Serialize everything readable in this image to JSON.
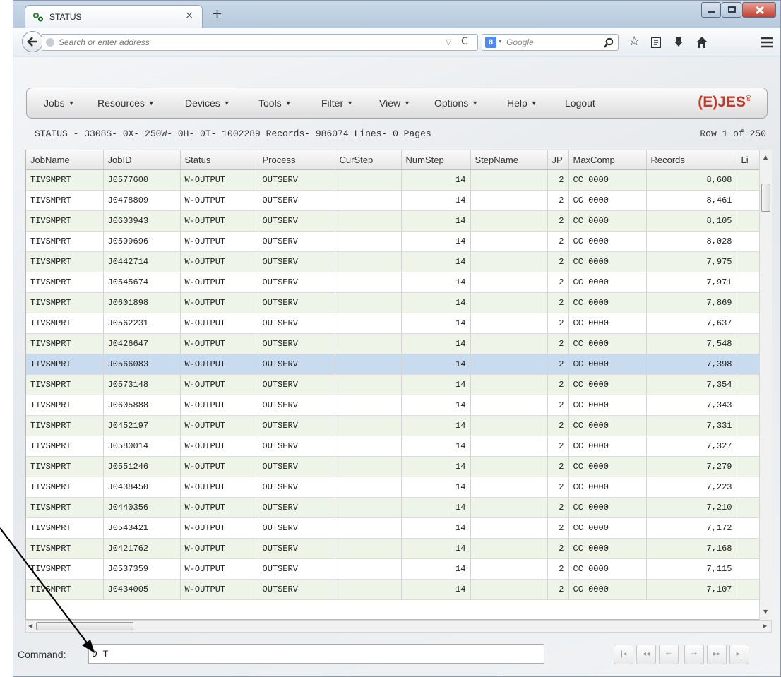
{
  "browser": {
    "tab_title": "STATUS",
    "tab_close": "×",
    "new_tab": "+",
    "url_placeholder": "Search or enter address",
    "search_badge": "8",
    "search_placeholder": "Google"
  },
  "menu": {
    "items": [
      {
        "label": "Jobs",
        "dropdown": true
      },
      {
        "label": "Resources",
        "dropdown": true
      },
      {
        "label": "Devices",
        "dropdown": true
      },
      {
        "label": "Tools",
        "dropdown": true
      },
      {
        "label": "Filter",
        "dropdown": true
      },
      {
        "label": "View",
        "dropdown": true
      },
      {
        "label": "Options",
        "dropdown": true
      },
      {
        "label": "Help",
        "dropdown": true
      },
      {
        "label": "Logout",
        "dropdown": false
      }
    ],
    "brand": "(E)JES",
    "brand_mark": "®"
  },
  "status_line": "STATUS - 3308S- 0X- 250W- 0H- 0T- 1002289 Records- 986074 Lines- 0 Pages",
  "row_info": "Row 1 of 250",
  "table": {
    "columns": [
      "JobName",
      "JobID",
      "Status",
      "Process",
      "CurStep",
      "NumStep",
      "StepName",
      "JP",
      "MaxComp",
      "Records",
      "Li"
    ],
    "rows": [
      [
        "TIVSMPRT",
        "J0577600",
        "W-OUTPUT",
        "OUTSERV",
        "",
        "14",
        "",
        "2",
        "CC 0000",
        "8,608"
      ],
      [
        "TIVSMPRT",
        "J0478809",
        "W-OUTPUT",
        "OUTSERV",
        "",
        "14",
        "",
        "2",
        "CC 0000",
        "8,461"
      ],
      [
        "TIVSMPRT",
        "J0603943",
        "W-OUTPUT",
        "OUTSERV",
        "",
        "14",
        "",
        "2",
        "CC 0000",
        "8,105"
      ],
      [
        "TIVSMPRT",
        "J0599696",
        "W-OUTPUT",
        "OUTSERV",
        "",
        "14",
        "",
        "2",
        "CC 0000",
        "8,028"
      ],
      [
        "TIVSMPRT",
        "J0442714",
        "W-OUTPUT",
        "OUTSERV",
        "",
        "14",
        "",
        "2",
        "CC 0000",
        "7,975"
      ],
      [
        "TIVSMPRT",
        "J0545674",
        "W-OUTPUT",
        "OUTSERV",
        "",
        "14",
        "",
        "2",
        "CC 0000",
        "7,971"
      ],
      [
        "TIVSMPRT",
        "J0601898",
        "W-OUTPUT",
        "OUTSERV",
        "",
        "14",
        "",
        "2",
        "CC 0000",
        "7,869"
      ],
      [
        "TIVSMPRT",
        "J0562231",
        "W-OUTPUT",
        "OUTSERV",
        "",
        "14",
        "",
        "2",
        "CC 0000",
        "7,637"
      ],
      [
        "TIVSMPRT",
        "J0426647",
        "W-OUTPUT",
        "OUTSERV",
        "",
        "14",
        "",
        "2",
        "CC 0000",
        "7,548"
      ],
      [
        "TIVSMPRT",
        "J0566083",
        "W-OUTPUT",
        "OUTSERV",
        "",
        "14",
        "",
        "2",
        "CC 0000",
        "7,398"
      ],
      [
        "TIVSMPRT",
        "J0573148",
        "W-OUTPUT",
        "OUTSERV",
        "",
        "14",
        "",
        "2",
        "CC 0000",
        "7,354"
      ],
      [
        "TIVSMPRT",
        "J0605888",
        "W-OUTPUT",
        "OUTSERV",
        "",
        "14",
        "",
        "2",
        "CC 0000",
        "7,343"
      ],
      [
        "TIVSMPRT",
        "J0452197",
        "W-OUTPUT",
        "OUTSERV",
        "",
        "14",
        "",
        "2",
        "CC 0000",
        "7,331"
      ],
      [
        "TIVSMPRT",
        "J0580014",
        "W-OUTPUT",
        "OUTSERV",
        "",
        "14",
        "",
        "2",
        "CC 0000",
        "7,327"
      ],
      [
        "TIVSMPRT",
        "J0551246",
        "W-OUTPUT",
        "OUTSERV",
        "",
        "14",
        "",
        "2",
        "CC 0000",
        "7,279"
      ],
      [
        "TIVSMPRT",
        "J0438450",
        "W-OUTPUT",
        "OUTSERV",
        "",
        "14",
        "",
        "2",
        "CC 0000",
        "7,223"
      ],
      [
        "TIVSMPRT",
        "J0440356",
        "W-OUTPUT",
        "OUTSERV",
        "",
        "14",
        "",
        "2",
        "CC 0000",
        "7,210"
      ],
      [
        "TIVSMPRT",
        "J0543421",
        "W-OUTPUT",
        "OUTSERV",
        "",
        "14",
        "",
        "2",
        "CC 0000",
        "7,172"
      ],
      [
        "TIVSMPRT",
        "J0421762",
        "W-OUTPUT",
        "OUTSERV",
        "",
        "14",
        "",
        "2",
        "CC 0000",
        "7,168"
      ],
      [
        "TIVSMPRT",
        "J0537359",
        "W-OUTPUT",
        "OUTSERV",
        "",
        "14",
        "",
        "2",
        "CC 0000",
        "7,115"
      ],
      [
        "TIVSMPRT",
        "J0434005",
        "W-OUTPUT",
        "OUTSERV",
        "",
        "14",
        "",
        "2",
        "CC 0000",
        "7,107"
      ]
    ],
    "selected_row": 9
  },
  "command": {
    "label": "Command:",
    "value": "D T"
  },
  "pager": {
    "buttons": [
      {
        "name": "first-page-button",
        "glyph": "|◂"
      },
      {
        "name": "page-up-button",
        "glyph": "◂◂"
      },
      {
        "name": "scroll-left-button",
        "glyph": "←"
      },
      {
        "name": "scroll-right-button",
        "glyph": "→"
      },
      {
        "name": "page-down-button",
        "glyph": "▸▸"
      },
      {
        "name": "last-page-button",
        "glyph": "▸|"
      }
    ]
  },
  "colors": {
    "brand": "#c0392b",
    "row_alt": "#eef4e8",
    "row_selected": "#c9dcef"
  }
}
